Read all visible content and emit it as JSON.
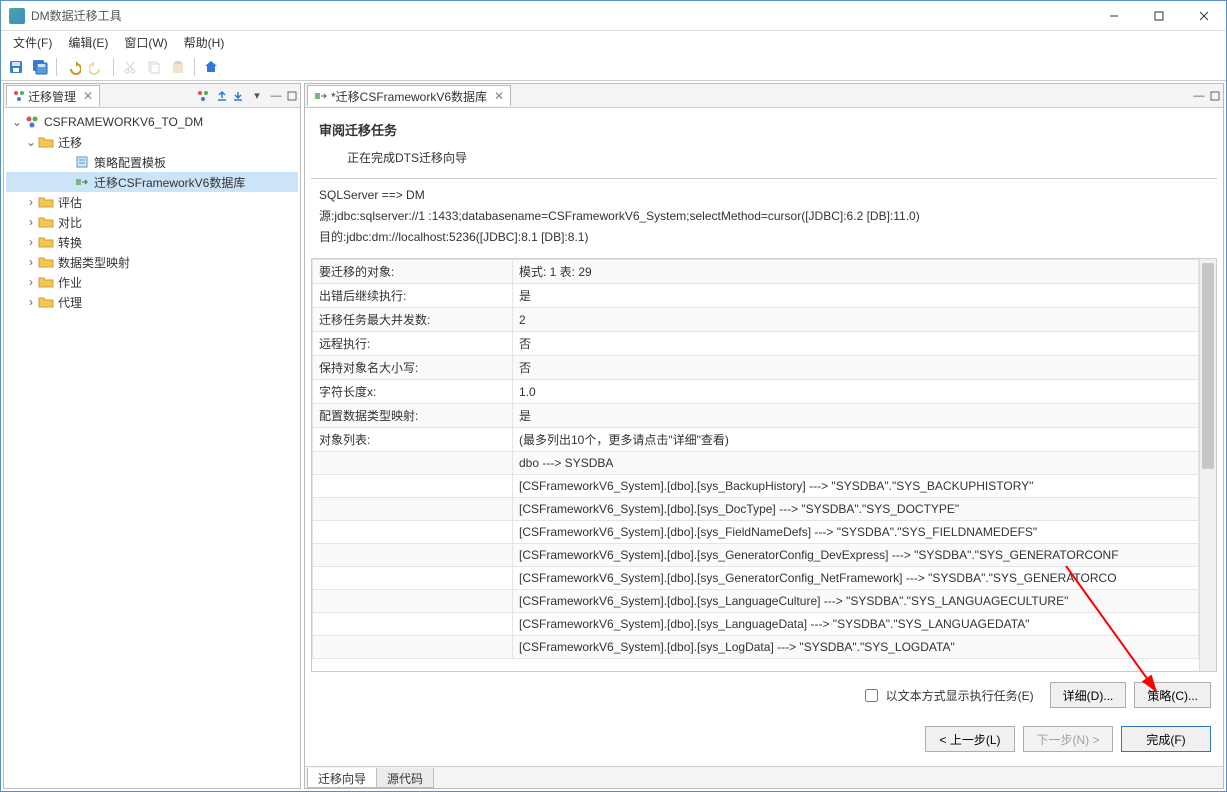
{
  "window": {
    "title": "DM数据迁移工具"
  },
  "menu": {
    "file": "文件(F)",
    "edit": "编辑(E)",
    "window": "窗口(W)",
    "help": "帮助(H)"
  },
  "left": {
    "tab_title": "迁移管理",
    "root": "CSFRAMEWORKV6_TO_DM",
    "migration": "迁移",
    "policy_template": "策略配置模板",
    "migrate_db": "迁移CSFrameworkV6数据库",
    "assess": "评估",
    "compare": "对比",
    "transform": "转换",
    "type_mapping": "数据类型映射",
    "job": "作业",
    "agent": "代理"
  },
  "right": {
    "tab_title": "*迁移CSFrameworkV6数据库",
    "review_title": "审阅迁移任务",
    "review_sub": "正在完成DTS迁移向导",
    "line1": "SQLServer ==> DM",
    "line2": "源:jdbc:sqlserver://1        :1433;databasename=CSFrameworkV6_System;selectMethod=cursor([JDBC]:6.2 [DB]:11.0)",
    "line3": "目的:jdbc:dm://localhost:5236([JDBC]:8.1 [DB]:8.1)",
    "show_text_exec": "以文本方式显示执行任务(E)",
    "detail": "详细(D)...",
    "strategy": "策略(C)...",
    "prev": "< 上一步(L)",
    "next": "下一步(N) >",
    "finish": "完成(F)",
    "bottom_tab1": "迁移向导",
    "bottom_tab2": "源代码"
  },
  "grid": {
    "rows": [
      {
        "k": "要迁移的对象:",
        "v": "模式: 1 表: 29"
      },
      {
        "k": "出错后继续执行:",
        "v": "是"
      },
      {
        "k": "迁移任务最大并发数:",
        "v": "2"
      },
      {
        "k": "远程执行:",
        "v": "否"
      },
      {
        "k": "保持对象名大小写:",
        "v": "否"
      },
      {
        "k": "字符长度x:",
        "v": "1.0"
      },
      {
        "k": "配置数据类型映射:",
        "v": "是"
      },
      {
        "k": "对象列表:",
        "v": "(最多列出10个，更多请点击\"详细\"查看)"
      },
      {
        "k": "",
        "v": "dbo ---> SYSDBA"
      },
      {
        "k": "",
        "v": "[CSFrameworkV6_System].[dbo].[sys_BackupHistory] ---> \"SYSDBA\".\"SYS_BACKUPHISTORY\""
      },
      {
        "k": "",
        "v": "[CSFrameworkV6_System].[dbo].[sys_DocType] ---> \"SYSDBA\".\"SYS_DOCTYPE\""
      },
      {
        "k": "",
        "v": "[CSFrameworkV6_System].[dbo].[sys_FieldNameDefs] ---> \"SYSDBA\".\"SYS_FIELDNAMEDEFS\""
      },
      {
        "k": "",
        "v": "[CSFrameworkV6_System].[dbo].[sys_GeneratorConfig_DevExpress] ---> \"SYSDBA\".\"SYS_GENERATORCONF"
      },
      {
        "k": "",
        "v": "[CSFrameworkV6_System].[dbo].[sys_GeneratorConfig_NetFramework] ---> \"SYSDBA\".\"SYS_GENERATORCO"
      },
      {
        "k": "",
        "v": "[CSFrameworkV6_System].[dbo].[sys_LanguageCulture] ---> \"SYSDBA\".\"SYS_LANGUAGECULTURE\""
      },
      {
        "k": "",
        "v": "[CSFrameworkV6_System].[dbo].[sys_LanguageData] ---> \"SYSDBA\".\"SYS_LANGUAGEDATA\""
      },
      {
        "k": "",
        "v": "[CSFrameworkV6_System].[dbo].[sys_LogData] ---> \"SYSDBA\".\"SYS_LOGDATA\""
      }
    ]
  }
}
